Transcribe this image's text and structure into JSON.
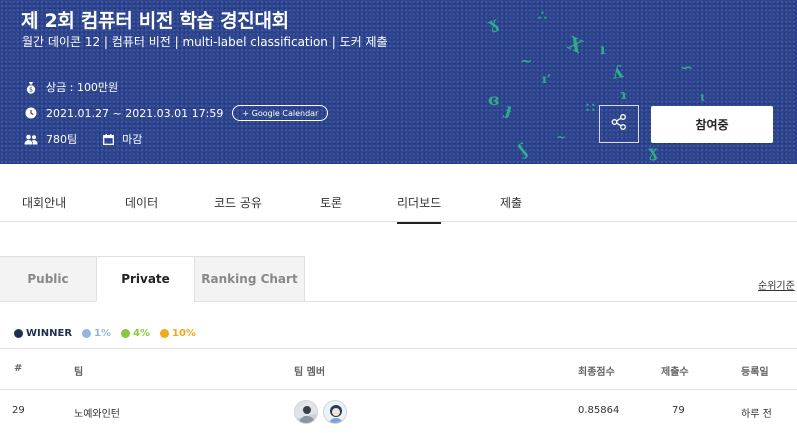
{
  "banner": {
    "title": "제 2회 컴퓨터 비전 학습 경진대회",
    "subtitle": "월간 데이콘 12 | 컴퓨터 비전 | multi-label classification | 도커 제출",
    "prize": "상금 : 100만원",
    "period": "2021.01.27 ~ 2021.03.01 17:59",
    "calendar_button": "+ Google Calendar",
    "teams": "780팀",
    "status": "마감",
    "join_button": "참여중",
    "accent_color": "#2d4590"
  },
  "tabs": [
    "대회안내",
    "데이터",
    "코드 공유",
    "토론",
    "리더보드",
    "제출"
  ],
  "active_tab": "리더보드",
  "subtabs": [
    "Public",
    "Private",
    "Ranking Chart"
  ],
  "active_subtab": "Private",
  "sort_link": "순위기준",
  "legend": [
    {
      "label": "WINNER",
      "color": "#1e2f4d"
    },
    {
      "label": "1%",
      "color": "#8fb8dc"
    },
    {
      "label": "4%",
      "color": "#8cc63f"
    },
    {
      "label": "10%",
      "color": "#f0a81e"
    }
  ],
  "table": {
    "headers": [
      "#",
      "팀",
      "팀 멤버",
      "최종점수",
      "제출수",
      "등록일"
    ],
    "rows": [
      {
        "rank": "29",
        "team": "노예와인턴",
        "score": "0.85864",
        "submissions": "79",
        "date": "하루 전"
      }
    ]
  }
}
